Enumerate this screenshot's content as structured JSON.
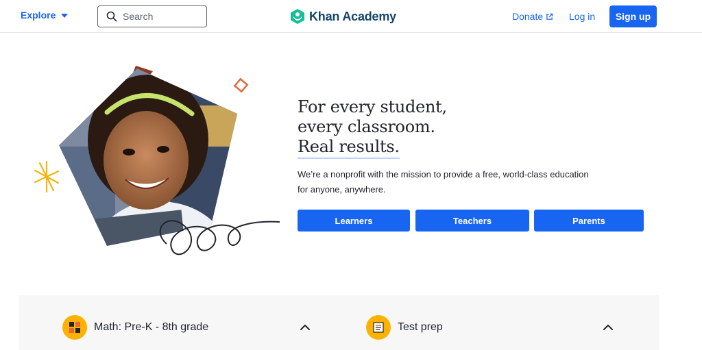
{
  "header": {
    "explore_label": "Explore",
    "search_placeholder": "Search",
    "logo_text": "Khan Academy",
    "donate_label": "Donate",
    "login_label": "Log in",
    "signup_label": "Sign up"
  },
  "hero": {
    "headline_line1": "For every student,",
    "headline_line2": "every classroom.",
    "headline_line3": "Real results.",
    "subtext": "We’re a nonprofit with the mission to provide a free, world-class education for anyone, anywhere.",
    "buttons": [
      "Learners",
      "Teachers",
      "Parents"
    ]
  },
  "courses": [
    {
      "label": "Math: Pre-K - 8th grade",
      "icon": "math-blocks-icon"
    },
    {
      "label": "Test prep",
      "icon": "test-prep-icon"
    }
  ],
  "colors": {
    "brand_blue": "#1865f2",
    "logo_green": "#14bf96",
    "logo_navy": "#14446a",
    "course_icon_yellow": "#ffb100",
    "panel_gray": "#f7f7f7"
  }
}
